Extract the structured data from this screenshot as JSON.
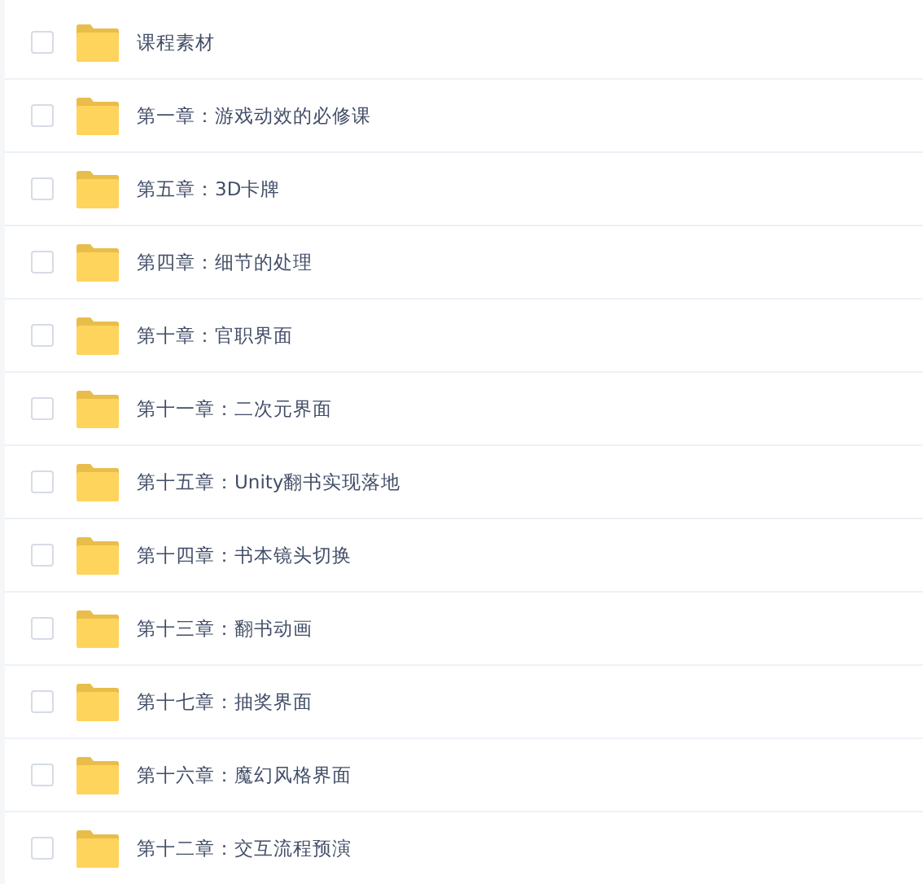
{
  "files": [
    {
      "name": "课程素材",
      "checked": false
    },
    {
      "name": "第一章：游戏动效的必修课",
      "checked": false
    },
    {
      "name": "第五章：3D卡牌",
      "checked": false
    },
    {
      "name": "第四章：细节的处理",
      "checked": false
    },
    {
      "name": "第十章：官职界面",
      "checked": false
    },
    {
      "name": "第十一章：二次元界面",
      "checked": false
    },
    {
      "name": "第十五章：Unity翻书实现落地",
      "checked": false
    },
    {
      "name": "第十四章：书本镜头切换",
      "checked": false
    },
    {
      "name": "第十三章：翻书动画",
      "checked": false
    },
    {
      "name": "第十七章：抽奖界面",
      "checked": false
    },
    {
      "name": "第十六章：魔幻风格界面",
      "checked": false
    },
    {
      "name": "第十二章：交互流程预演",
      "checked": false
    }
  ]
}
